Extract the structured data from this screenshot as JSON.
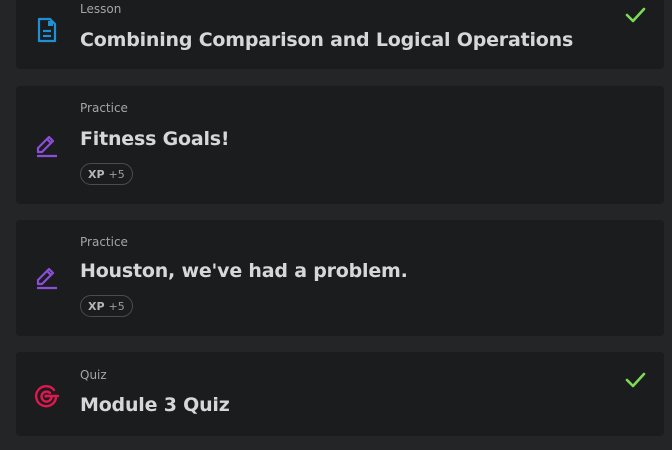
{
  "items": [
    {
      "kind": "Lesson",
      "title": "Combining Comparison and Logical Operations",
      "icon": "lesson-document-icon",
      "completed": true
    },
    {
      "kind": "Practice",
      "title": "Fitness Goals!",
      "icon": "practice-pencil-icon",
      "xp_label": "XP",
      "xp_value": "+5",
      "completed": false
    },
    {
      "kind": "Practice",
      "title": "Houston, we've had a problem.",
      "icon": "practice-pencil-icon",
      "xp_label": "XP",
      "xp_value": "+5",
      "completed": false
    },
    {
      "kind": "Quiz",
      "title": "Module 3 Quiz",
      "icon": "quiz-target-icon",
      "completed": true
    }
  ],
  "colors": {
    "lesson_icon": "#1e90d6",
    "practice_icon": "#8a4fd6",
    "quiz_icon": "#e0184f",
    "check": "#7ed957"
  }
}
